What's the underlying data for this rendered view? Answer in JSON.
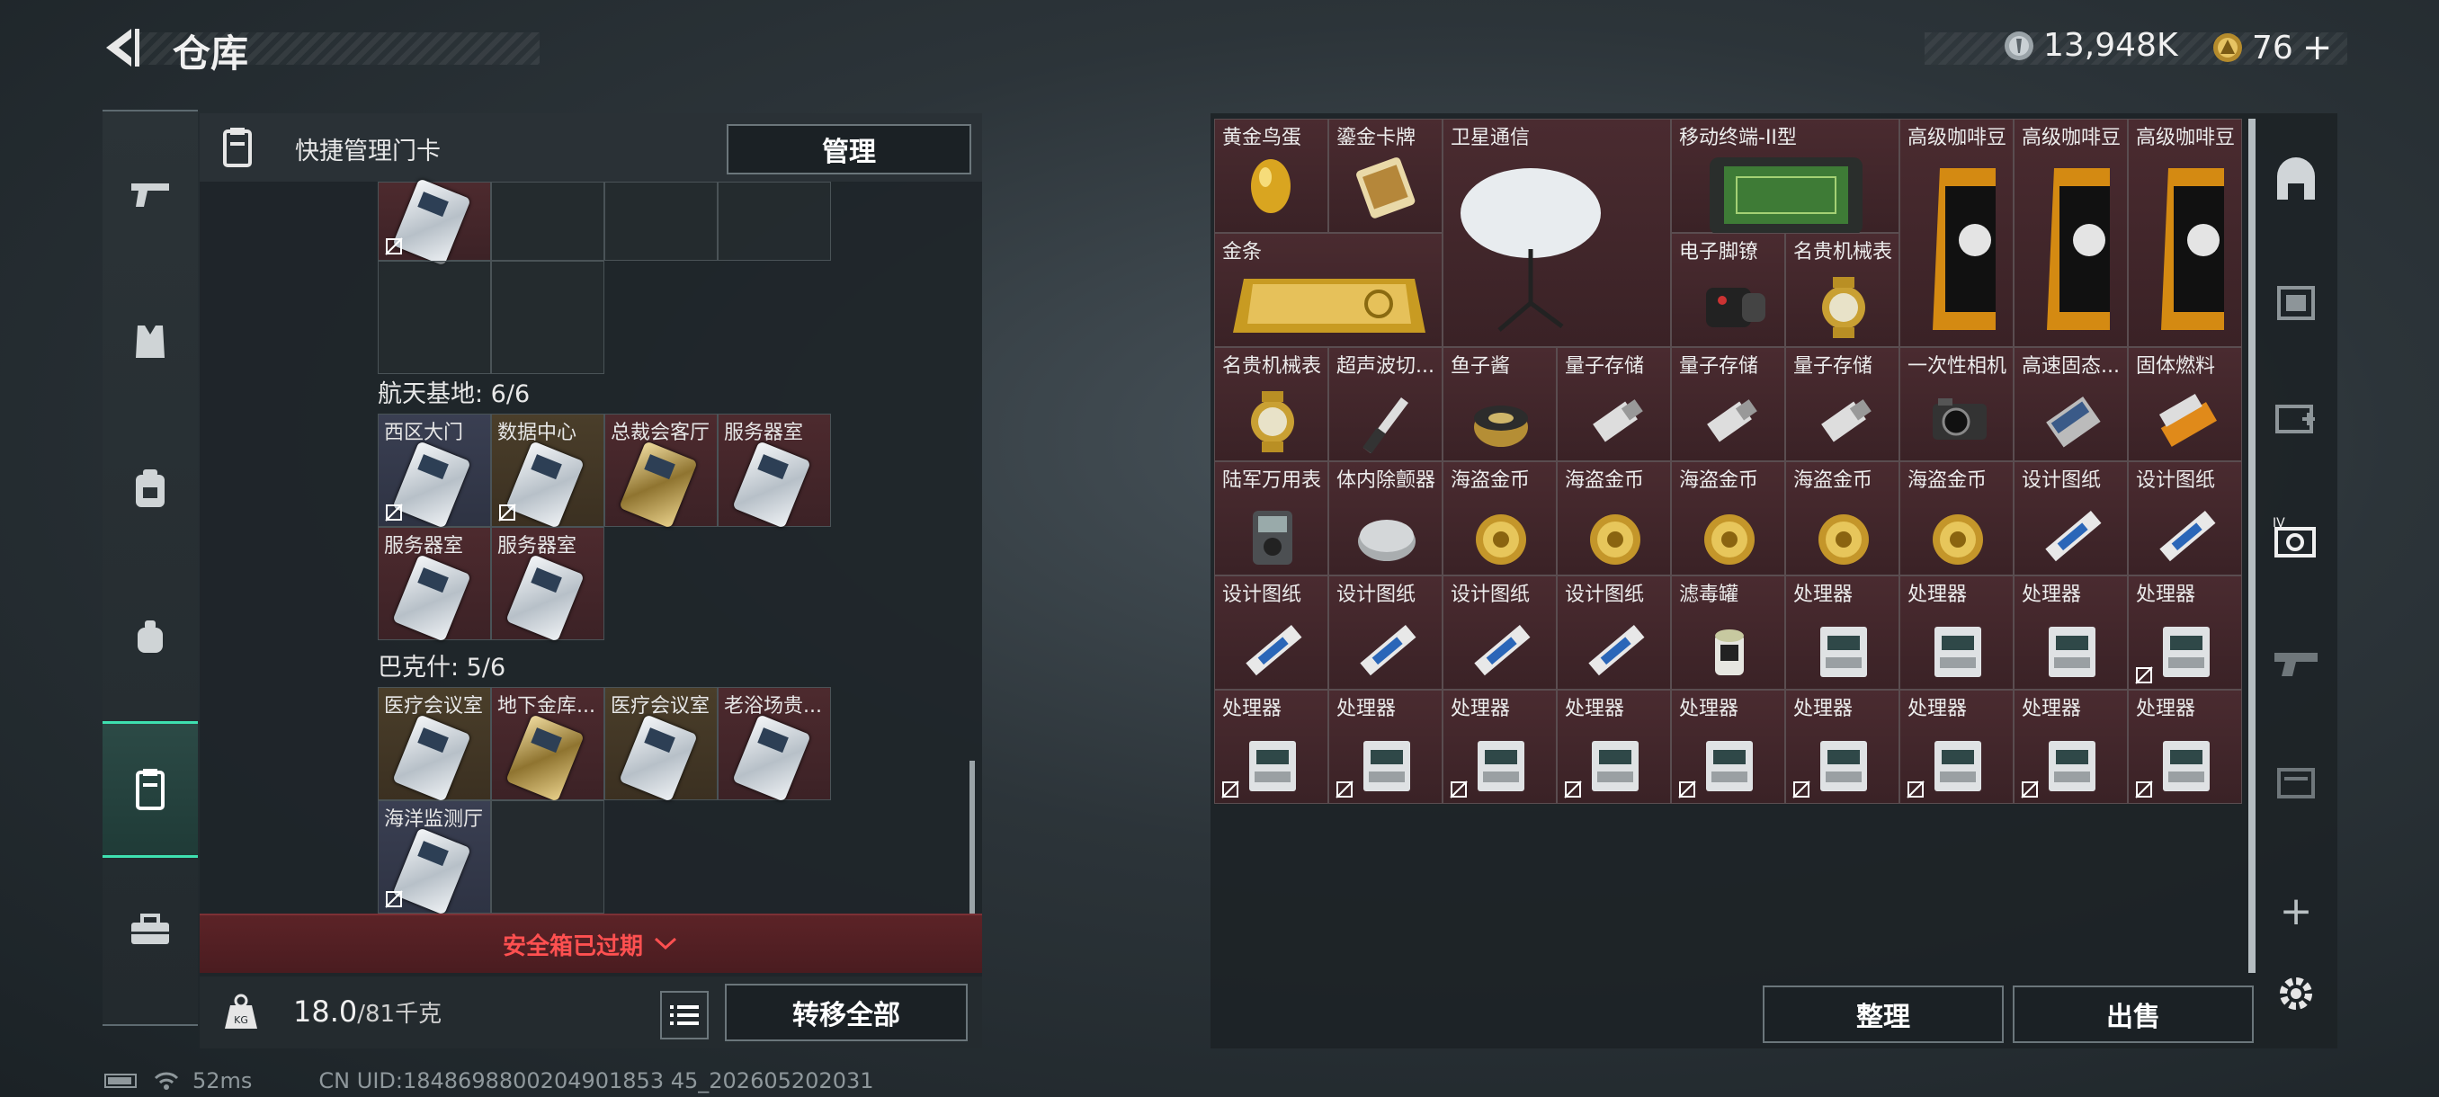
{
  "header": {
    "title": "仓库",
    "currency_silver": "13,948K",
    "currency_gold": "76"
  },
  "left_panel": {
    "header_label": "快捷管理门卡",
    "manage_label": "管理",
    "sections": [
      {
        "title": "航天基地: 6/6",
        "cards": [
          "西区大门",
          "数据中心",
          "总裁会客厅",
          "服务器室",
          "服务器室",
          "服务器室"
        ]
      },
      {
        "title": "巴克什: 5/6",
        "cards": [
          "医疗会议室",
          "地下金库...",
          "医疗会议室",
          "老浴场贵...",
          "海洋监测厅"
        ]
      }
    ],
    "expired_label": "安全箱已过期",
    "weight_value": "18.0",
    "weight_max": "/81千克",
    "move_all_label": "转移全部"
  },
  "grid": {
    "items": [
      {
        "label": "黄金鸟蛋"
      },
      {
        "label": "鎏金卡牌"
      },
      {
        "label": "卫星通信"
      },
      {
        "label": "移动终端-II型"
      },
      {
        "label": "高级咖啡豆"
      },
      {
        "label": "高级咖啡豆"
      },
      {
        "label": "高级咖啡豆"
      },
      {
        "label": "金条"
      },
      {
        "label": "电子脚镣"
      },
      {
        "label": "名贵机械表"
      },
      {
        "label": "名贵机械表"
      },
      {
        "label": "超声波切..."
      },
      {
        "label": "鱼子酱"
      },
      {
        "label": "量子存储"
      },
      {
        "label": "量子存储"
      },
      {
        "label": "量子存储"
      },
      {
        "label": "一次性相机"
      },
      {
        "label": "高速固态..."
      },
      {
        "label": "固体燃料"
      },
      {
        "label": "陆军万用表"
      },
      {
        "label": "体内除颤器"
      },
      {
        "label": "海盗金币"
      },
      {
        "label": "海盗金币"
      },
      {
        "label": "海盗金币"
      },
      {
        "label": "海盗金币"
      },
      {
        "label": "海盗金币"
      },
      {
        "label": "设计图纸"
      },
      {
        "label": "设计图纸"
      },
      {
        "label": "设计图纸"
      },
      {
        "label": "设计图纸"
      },
      {
        "label": "设计图纸"
      },
      {
        "label": "设计图纸"
      },
      {
        "label": "滤毒罐"
      },
      {
        "label": "处理器"
      },
      {
        "label": "处理器"
      },
      {
        "label": "处理器"
      },
      {
        "label": "处理器"
      },
      {
        "label": "处理器"
      },
      {
        "label": "处理器"
      },
      {
        "label": "处理器"
      },
      {
        "label": "处理器"
      },
      {
        "label": "处理器"
      },
      {
        "label": "处理器"
      },
      {
        "label": "处理器"
      },
      {
        "label": "处理器"
      },
      {
        "label": "处理器"
      }
    ]
  },
  "buttons": {
    "sort_label": "整理",
    "sell_label": "出售"
  },
  "status": {
    "ping": "52ms",
    "uid": "CN UID:1848698800204901853 45_202605202031"
  }
}
